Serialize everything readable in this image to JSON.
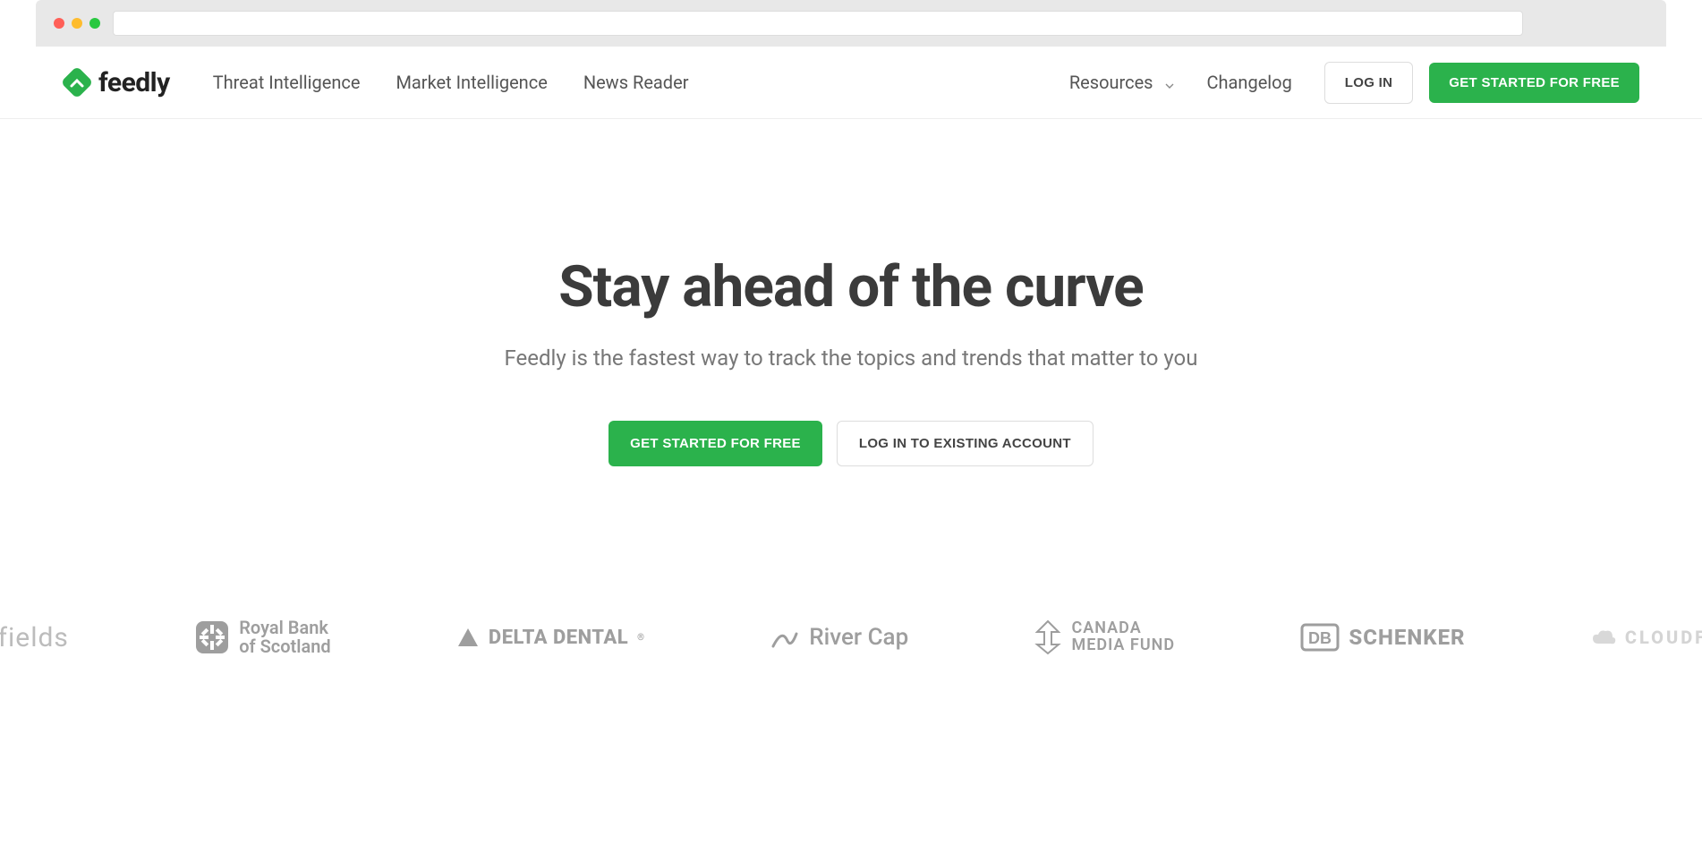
{
  "brand": {
    "name": "feedly"
  },
  "nav": {
    "links": [
      "Threat Intelligence",
      "Market Intelligence",
      "News Reader"
    ],
    "right": {
      "resources": "Resources",
      "changelog": "Changelog",
      "login": "LOG IN",
      "get_started": "GET STARTED FOR FREE"
    }
  },
  "hero": {
    "title": "Stay ahead of the curve",
    "subtitle": "Feedly is the fastest way to track the topics and trends that matter to you",
    "cta_primary": "GET STARTED FOR FREE",
    "cta_secondary": "LOG IN TO EXISTING ACCOUNT"
  },
  "clients": {
    "left_partial": "nfields",
    "rbs_line1": "Royal Bank",
    "rbs_line2": "of Scotland",
    "delta": "DELTA DENTAL",
    "rivercap": "River Cap",
    "cmf_line1": "CANADA",
    "cmf_line2": "MEDIA FUND",
    "schenker": "SCHENKER",
    "right_partial": "CLOUDFL"
  }
}
